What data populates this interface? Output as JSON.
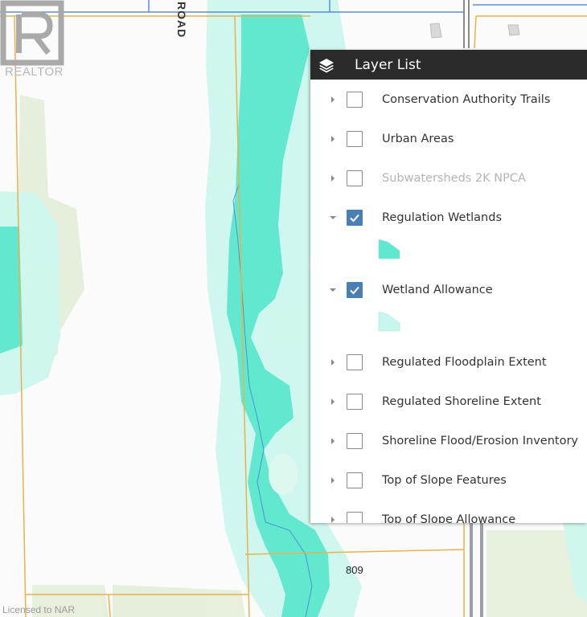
{
  "map": {
    "watermark_text": "REALTOR",
    "road_label": "ROAD",
    "lot_number": "809",
    "license_text": "Licensed to NAR"
  },
  "panel": {
    "title": "Layer List",
    "icon": "layers-icon",
    "layers": [
      {
        "label": "Conservation Authority Trails",
        "checked": false,
        "expanded": false,
        "disabled": false
      },
      {
        "label": "Urban Areas",
        "checked": false,
        "expanded": false,
        "disabled": false
      },
      {
        "label": "Subwatersheds 2K NPCA",
        "checked": false,
        "expanded": false,
        "disabled": true
      },
      {
        "label": "Regulation Wetlands",
        "checked": true,
        "expanded": true,
        "disabled": false,
        "swatch": "#5ee8cf"
      },
      {
        "label": "Wetland Allowance",
        "checked": true,
        "expanded": true,
        "disabled": false,
        "swatch": "#c8f6ec"
      },
      {
        "label": "Regulated Floodplain Extent",
        "checked": false,
        "expanded": false,
        "disabled": false
      },
      {
        "label": "Regulated Shoreline Extent",
        "checked": false,
        "expanded": false,
        "disabled": false
      },
      {
        "label": "Shoreline Flood/Erosion Inventory",
        "checked": false,
        "expanded": false,
        "disabled": false
      },
      {
        "label": "Top of Slope Features",
        "checked": false,
        "expanded": false,
        "disabled": false
      },
      {
        "label": "Top of Slope Allowance",
        "checked": false,
        "expanded": false,
        "disabled": false
      }
    ]
  },
  "colors": {
    "wetland": "#5ee8cf",
    "wetland_allowance": "#c8f6ec",
    "vegetation": "#e3eed6",
    "lot_line": "#e8b24a",
    "road": "#9aa0a6",
    "stream": "#3f7fd6",
    "header_bg": "#2b2b2b",
    "checkbox_checked": "#4a7fb5"
  }
}
